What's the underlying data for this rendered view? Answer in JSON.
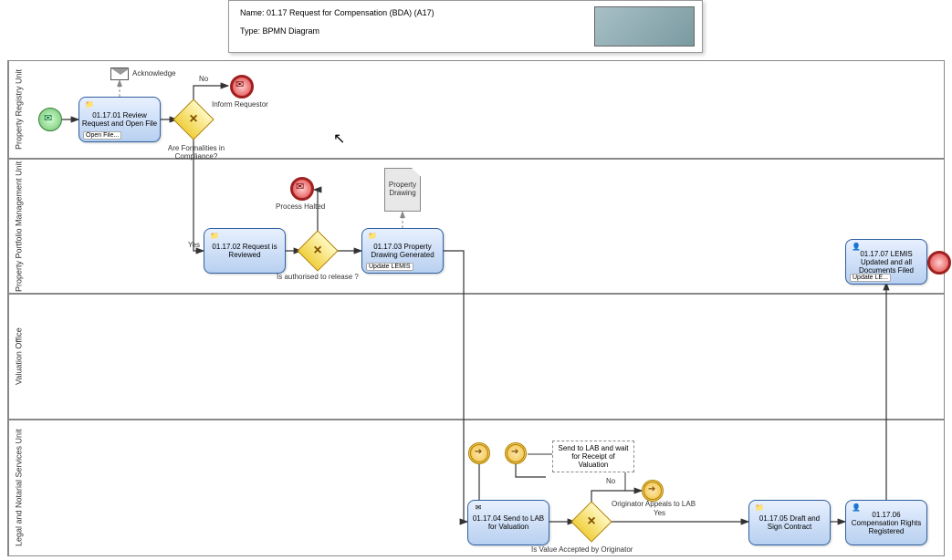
{
  "header": {
    "name_label": "Name:",
    "name_value": "01.17 Request for Compensation (BDA)  (A17)",
    "type_label": "Type:",
    "type_value": "BPMN Diagram"
  },
  "lanes": {
    "l1": "Property Registry Unit",
    "l2": "Property Portfolio Management Unit",
    "l3": "Valuation Office",
    "l4": "Legal and Notarial Services Unit"
  },
  "tasks": {
    "t1": "01.17.01 Review Request and Open File",
    "t1_sub": "Open File...",
    "t2": "01.17.02 Request is Reviewed",
    "t3": "01.17.03 Property Drawing Generated",
    "t3_sub": "Update LEMIS",
    "t4": "01.17.04 Send to LAB for Valuation",
    "t5": "01.17.05 Draft and Sign Contract",
    "t6": "01.17.06 Compensation Rights Registered",
    "t7": "01.17.07 LEMIS Updated  and all Documents Filed",
    "t7_sub": "Update LE..."
  },
  "gateways": {
    "g1": "Are Formalities in Compliance?",
    "g2": "Is authorised to release ?",
    "g3": "Is Value Accepted by Originator"
  },
  "labels": {
    "ack": "Acknowledge",
    "no": "No",
    "yes": "Yes",
    "inform": "Inform Requestor",
    "halted": "Process Halted",
    "drawing": "Property Drawing",
    "annot": "Send to LAB and wait for Receipt of Valuation",
    "appeal": "Originator Appeals to LAB",
    "no2": "No",
    "yes2": "Yes"
  }
}
